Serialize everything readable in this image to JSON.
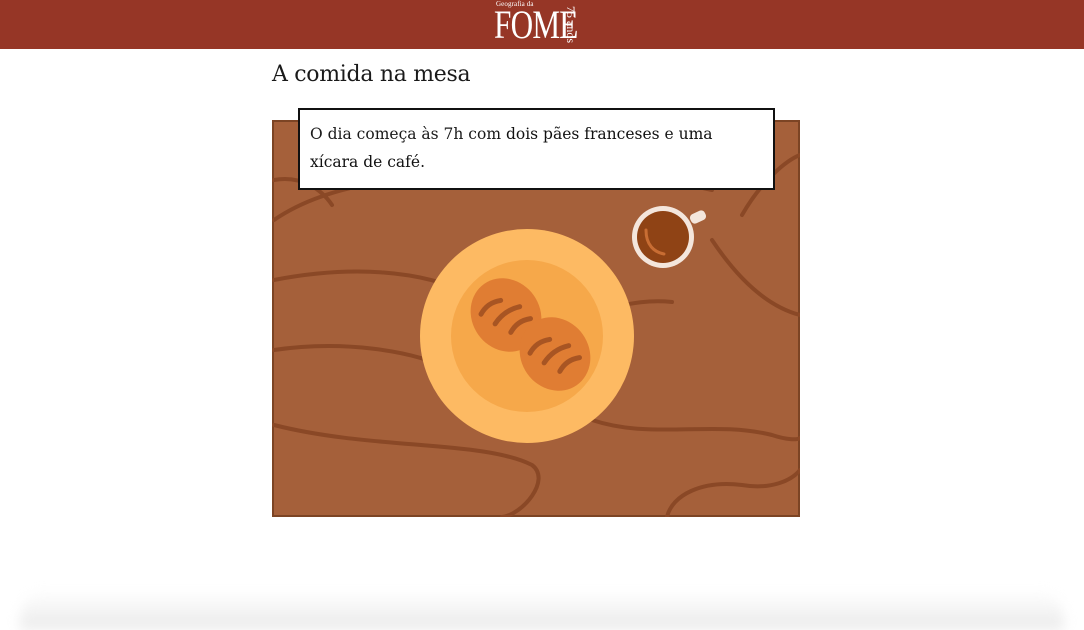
{
  "header": {
    "logo": {
      "small_text": "Geografia da",
      "big_text": "FOME",
      "number_text": "75 anos"
    },
    "background_color": "#963626"
  },
  "main": {
    "title": "A comida na mesa",
    "caption": {
      "part1": "O dia começa às 7h com ",
      "highlight1": "dois pães franceses",
      "part2": " e ",
      "highlight2": "uma xícara de café",
      "part3": "."
    },
    "illustration": {
      "table_color": "#a5603a",
      "grain_color": "#8a4826",
      "plate_outer_color": "#fdba63",
      "plate_inner_color": "#f6a84a",
      "bread_color": "#e07d33",
      "bread_cut_color": "#a85523",
      "cup_color": "#f4e6dc",
      "coffee_color": "#8f4315"
    }
  }
}
